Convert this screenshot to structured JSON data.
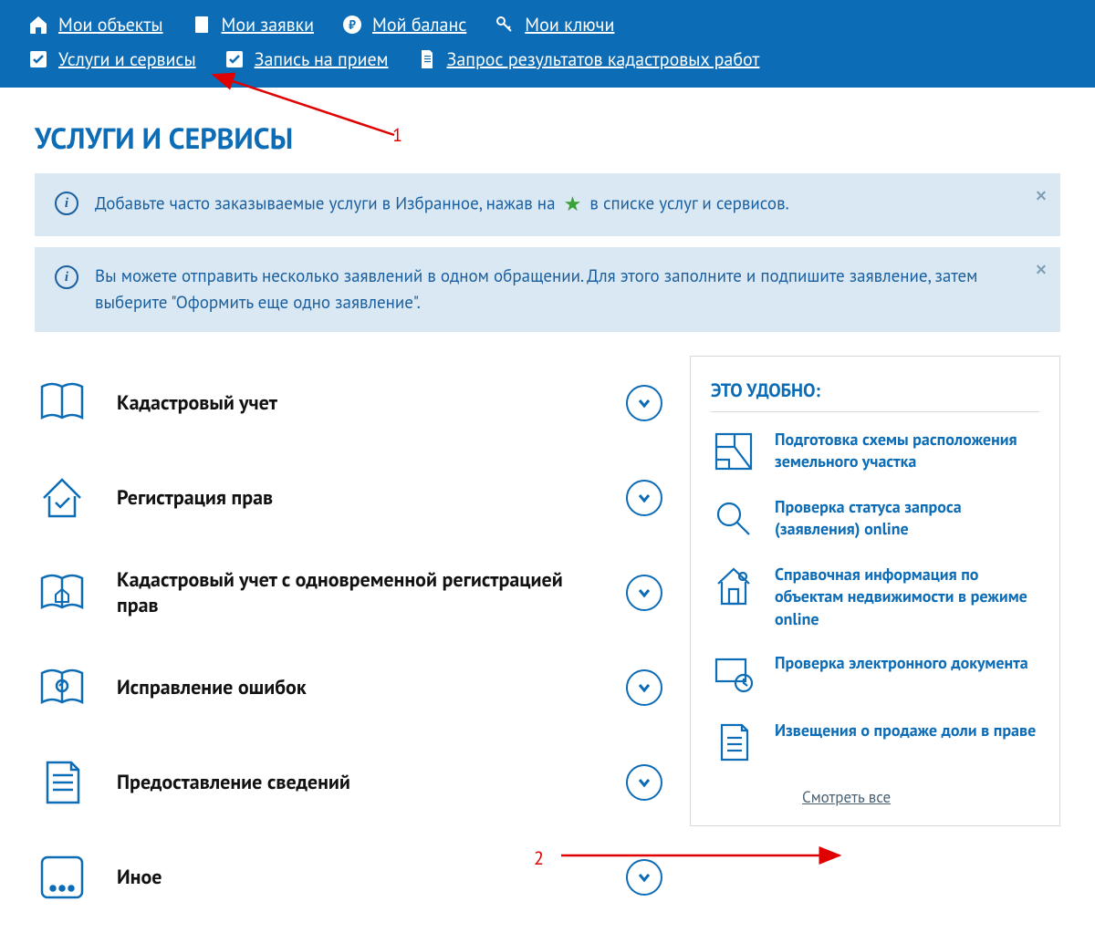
{
  "nav": {
    "row1": [
      {
        "label": "Мои объекты",
        "icon": "home"
      },
      {
        "label": "Мои заявки",
        "icon": "doc"
      },
      {
        "label": "Мой баланс",
        "icon": "ruble"
      },
      {
        "label": "Мои ключи",
        "icon": "key"
      }
    ],
    "row2": [
      {
        "label": "Услуги и сервисы",
        "icon": "check"
      },
      {
        "label": "Запись на прием",
        "icon": "check"
      },
      {
        "label": "Запрос результатов кадастровых работ",
        "icon": "page"
      }
    ]
  },
  "page_title": "УСЛУГИ И СЕРВИСЫ",
  "info1_a": "Добавьте часто заказываемые услуги в Избранное, нажав на",
  "info1_b": "в списке услуг и сервисов.",
  "info2": "Вы можете отправить несколько заявлений в одном обращении. Для этого заполните и подпишите заявление, затем выберите \"Оформить еще одно заявление\".",
  "categories": [
    {
      "title": "Кадастровый учет",
      "icon": "book"
    },
    {
      "title": "Регистрация прав",
      "icon": "house-ok"
    },
    {
      "title": "Кадастровый учет с одновременной регистрацией прав",
      "icon": "book-house"
    },
    {
      "title": "Исправление ошибок",
      "icon": "book-edit"
    },
    {
      "title": "Предоставление сведений",
      "icon": "sheet"
    },
    {
      "title": "Иное",
      "icon": "dots"
    }
  ],
  "sidebar": {
    "title": "ЭТО УДОБНО:",
    "items": [
      {
        "text": "Подготовка схемы расположения земельного участка",
        "icon": "plan"
      },
      {
        "text": "Проверка статуса запроса (заявления) online",
        "icon": "search"
      },
      {
        "text": "Справочная информация по объектам недвижимости в режиме online",
        "icon": "house-info"
      },
      {
        "text": "Проверка электронного документа",
        "icon": "screen"
      },
      {
        "text": "Извещения о продаже доли в праве",
        "icon": "doc-side"
      }
    ],
    "see_all": "Смотреть все"
  },
  "annotations": {
    "a1": "1",
    "a2": "2"
  }
}
